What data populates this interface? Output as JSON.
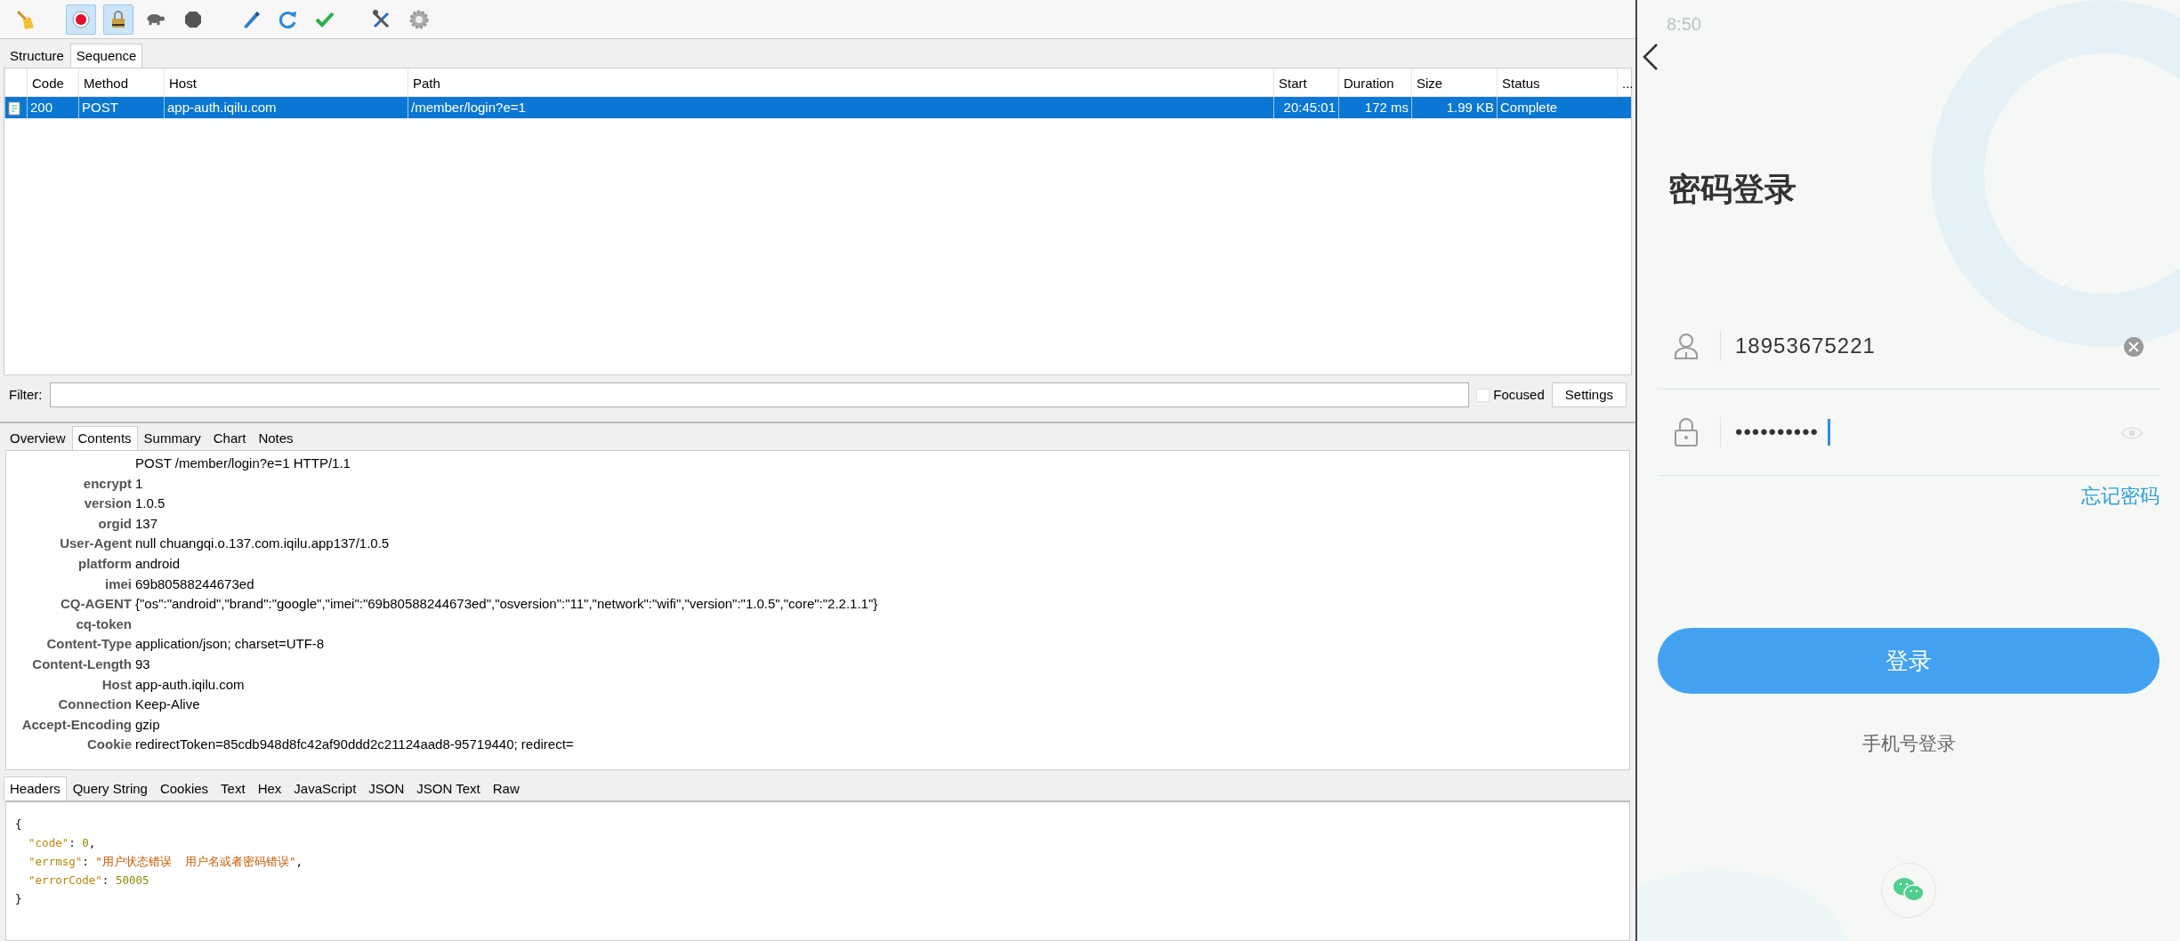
{
  "toolbar": [
    {
      "kind": "broom",
      "pressed": false
    },
    {
      "kind": "record",
      "pressed": true
    },
    {
      "kind": "throttle",
      "pressed": true
    },
    {
      "kind": "turtle",
      "pressed": false
    },
    {
      "kind": "stop",
      "pressed": false
    },
    {
      "kind": "pen",
      "pressed": false
    },
    {
      "kind": "refresh",
      "pressed": false
    },
    {
      "kind": "check",
      "pressed": false
    },
    {
      "kind": "tools",
      "pressed": false
    },
    {
      "kind": "gear",
      "pressed": false
    }
  ],
  "view_tabs": [
    {
      "label": "Structure",
      "selected": false
    },
    {
      "label": "Sequence",
      "selected": true
    }
  ],
  "table": {
    "columns": [
      "Code",
      "Method",
      "Host",
      "Path",
      "Start",
      "Duration",
      "Size",
      "Status",
      "..."
    ],
    "rows": [
      {
        "selected": true,
        "cells": [
          "200",
          "POST",
          "app-auth.iqilu.com",
          "/member/login?e=1",
          "20:45:01",
          "172 ms",
          "1.99 KB",
          "Complete"
        ]
      }
    ]
  },
  "filter": {
    "label": "Filter:",
    "focused": {
      "label": "Focused",
      "checked": false
    },
    "settings_button": "Settings"
  },
  "detail_tabs": [
    {
      "label": "Overview",
      "selected": false
    },
    {
      "label": "Contents",
      "selected": true
    },
    {
      "label": "Summary",
      "selected": false
    },
    {
      "label": "Chart",
      "selected": false
    },
    {
      "label": "Notes",
      "selected": false
    }
  ],
  "request": {
    "request_line": "POST /member/login?e=1 HTTP/1.1",
    "headers": [
      {
        "name": "encrypt",
        "value": "1"
      },
      {
        "name": "version",
        "value": "1.0.5"
      },
      {
        "name": "orgid",
        "value": "137"
      },
      {
        "name": "User-Agent",
        "value": "null chuangqi.o.137.com.iqilu.app137/1.0.5"
      },
      {
        "name": "platform",
        "value": "android"
      },
      {
        "name": "imei",
        "value": "69b80588244673ed"
      },
      {
        "name": "CQ-AGENT",
        "value": "{\"os\":\"android\",\"brand\":\"google\",\"imei\":\"69b80588244673ed\",\"osversion\":\"11\",\"network\":\"wifi\",\"version\":\"1.0.5\",\"core\":\"2.2.1.1\"}"
      },
      {
        "name": "cq-token"
      },
      {
        "name": "Content-Type",
        "value": "application/json; charset=UTF-8"
      },
      {
        "name": "Content-Length",
        "value": "93"
      },
      {
        "name": "Host",
        "value": "app-auth.iqilu.com"
      },
      {
        "name": "Connection",
        "value": "Keep-Alive"
      },
      {
        "name": "Accept-Encoding",
        "value": "gzip"
      },
      {
        "name": "Cookie",
        "value": "redirectToken=85cdb948d8fc42af90ddd2c21124aad8-95719440; redirect="
      }
    ]
  },
  "response_tabs": [
    {
      "label": "Headers",
      "selected": true
    },
    {
      "label": "Query String",
      "selected": false
    },
    {
      "label": "Cookies",
      "selected": false
    },
    {
      "label": "Text",
      "selected": false
    },
    {
      "label": "Hex",
      "selected": false
    },
    {
      "label": "JavaScript",
      "selected": false
    },
    {
      "label": "JSON",
      "selected": false
    },
    {
      "label": "JSON Text",
      "selected": false
    },
    {
      "label": "Raw",
      "selected": false
    }
  ],
  "response_body": {
    "lines": [
      [
        {
          "kind": "punct",
          "text": "{"
        }
      ],
      [
        {
          "kind": "key",
          "text": "  \"code\""
        },
        {
          "kind": "punct",
          "text": ": "
        },
        {
          "kind": "number",
          "text": "0"
        },
        {
          "kind": "punct",
          "text": ","
        }
      ],
      [
        {
          "kind": "key",
          "text": "  \"errmsg\""
        },
        {
          "kind": "punct",
          "text": ": "
        },
        {
          "kind": "string",
          "text": "\"用户状态错误  用户名或者密码错误\""
        },
        {
          "kind": "punct",
          "text": ","
        }
      ],
      [
        {
          "kind": "key",
          "text": "  \"errorCode\""
        },
        {
          "kind": "punct",
          "text": ": "
        },
        {
          "kind": "number",
          "text": "50005"
        }
      ],
      [
        {
          "kind": "punct",
          "text": "}"
        }
      ]
    ]
  },
  "phone": {
    "status_bar": {
      "time": "8:50"
    },
    "title": "密码登录",
    "phone_field": {
      "value": "18953675221"
    },
    "password_field": {
      "value": "••••••••••"
    },
    "forgot_link": "忘记密码",
    "login_button": "登录",
    "alt_login_link": "手机号登录"
  }
}
